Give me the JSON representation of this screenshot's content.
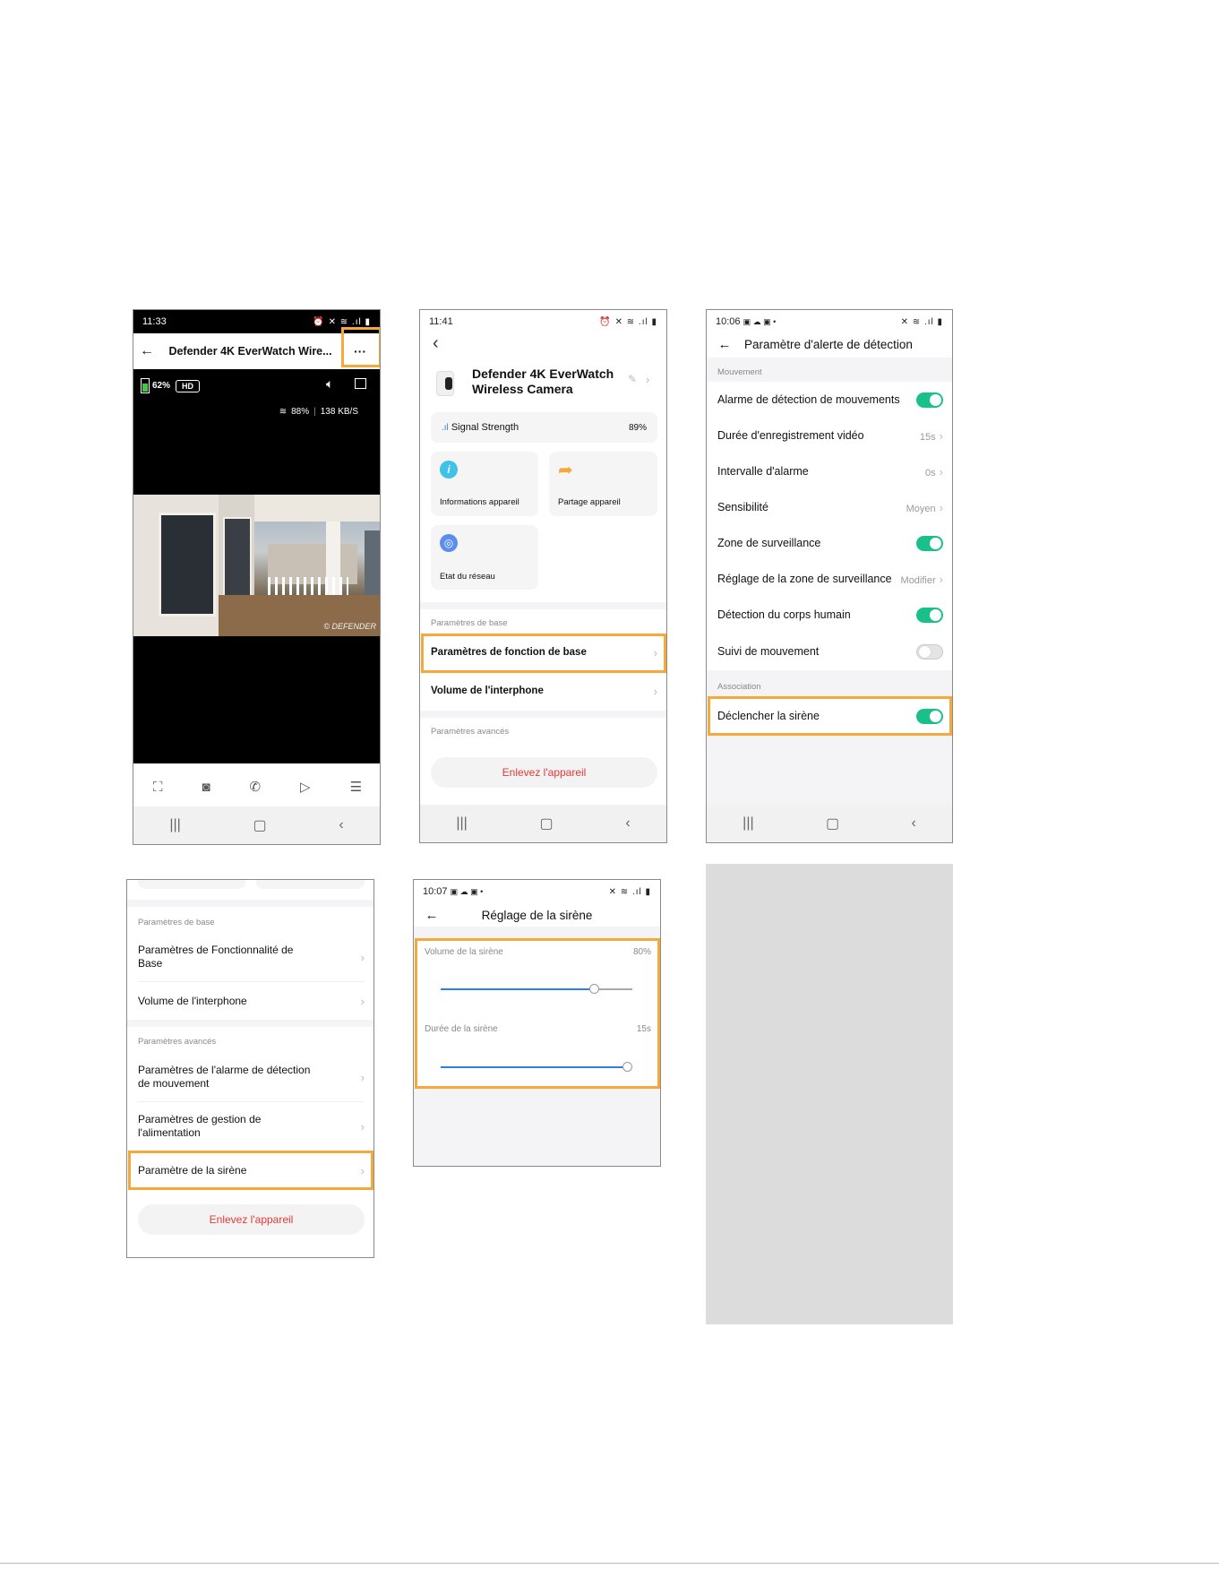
{
  "p1": {
    "time": "11:33",
    "status_icons": "⏰ ✕ ≋ .ıl ▮",
    "title": "Defender 4K EverWatch Wire...",
    "more": "···",
    "battery": "62%",
    "quality": "HD",
    "wifi_pct": "88%",
    "sep": "|",
    "speed": "138 KB/S",
    "watermark": "© DEFENDER"
  },
  "p2": {
    "time": "11:41",
    "status_icons": "⏰ ✕ ≋ .ıl ▮",
    "device_name": "Defender 4K EverWatch Wireless Camera",
    "signal_label": "Signal Strength",
    "signal_value": "89%",
    "card_info": "Informations appareil",
    "card_share": "Partage appareil",
    "card_network": "Etat du réseau",
    "basic_section": "Paramètres de base",
    "basic_item": "Paramètres de fonction de base",
    "volume_item": "Volume de l'interphone",
    "advanced_section": "Paramètres avancés",
    "remove": "Enlevez l'appareil"
  },
  "p3": {
    "time": "10:06",
    "status_icons": "✕ ≋ .ıl ▮",
    "title": "Paramètre d'alerte de détection",
    "section_motion": "Mouvement",
    "rows": [
      {
        "label": "Alarme de détection de mouvements",
        "type": "toggle",
        "on": true
      },
      {
        "label": "Durée d'enregistrement vidéo",
        "type": "value",
        "value": "15s"
      },
      {
        "label": "Intervalle d'alarme",
        "type": "value",
        "value": "0s"
      },
      {
        "label": "Sensibilité",
        "type": "value",
        "value": "Moyen"
      },
      {
        "label": "Zone de surveillance",
        "type": "toggle",
        "on": true
      },
      {
        "label": "Réglage de la zone de surveillance",
        "type": "value",
        "value": "Modifier"
      },
      {
        "label": "Détection du corps humain",
        "type": "toggle",
        "on": true
      },
      {
        "label": "Suivi de mouvement",
        "type": "toggle",
        "on": false
      }
    ],
    "section_association": "Association",
    "siren_row": "Déclencher la sirène"
  },
  "p4": {
    "basic_section": "Paramètres de base",
    "basic_item": "Paramètres de Fonctionnalité de Base",
    "volume_item": "Volume de l'interphone",
    "advanced_section": "Paramètres avancés",
    "motion_item": "Paramètres de l'alarme de détection de mouvement",
    "power_item": "Paramètres de gestion de l'alimentation",
    "siren_item": "Paramètre de la sirène",
    "remove": "Enlevez l'appareil"
  },
  "p5": {
    "time": "10:07",
    "status_icons": "✕ ≋ .ıl ▮",
    "title": "Réglage de la sirène",
    "volume_label": "Volume de la sirène",
    "volume_value": "80%",
    "volume_level": 0.8,
    "duration_label": "Durée de la sirène",
    "duration_value": "15s",
    "duration_level": 1.0
  },
  "colors": {
    "highlight": "#f4a93a",
    "toggle_on": "#19c08a",
    "danger": "#e53935",
    "slider": "#2f7fe0"
  }
}
